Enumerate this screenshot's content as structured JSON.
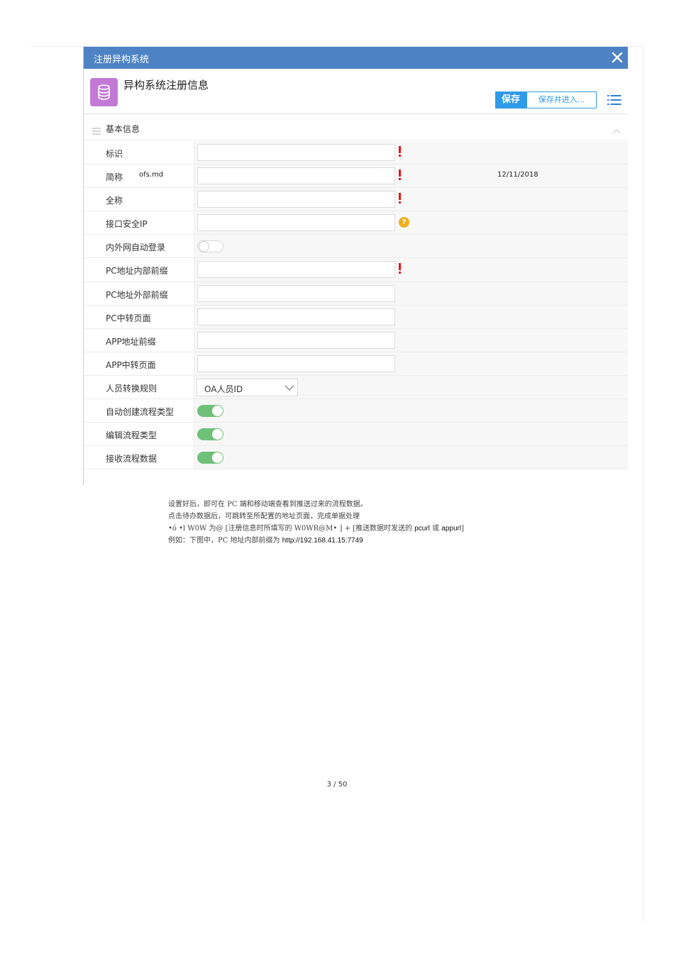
{
  "dialog": {
    "title": "注册异构系统",
    "heading": "异构系统注册信息",
    "save_label": "保存",
    "save_enter_label": "保存并进入...",
    "section_label": "基本信息",
    "rows": [
      {
        "label": "标识",
        "type": "input",
        "marker": "required"
      },
      {
        "label": "简称",
        "type": "input",
        "marker": "required"
      },
      {
        "label": "全称",
        "type": "input",
        "marker": "required"
      },
      {
        "label": "接口安全IP",
        "type": "input",
        "marker": "help"
      },
      {
        "label": "内外网自动登录",
        "type": "toggle",
        "on": false
      },
      {
        "label": "PC地址内部前缀",
        "type": "input",
        "marker": "required"
      },
      {
        "label": "PC地址外部前缀",
        "type": "input"
      },
      {
        "label": "PC中转页面",
        "type": "input"
      },
      {
        "label": "APP地址前缀",
        "type": "input"
      },
      {
        "label": "APP中转页面",
        "type": "input"
      },
      {
        "label": "人员转换规则",
        "type": "select",
        "value": "OA人员ID"
      },
      {
        "label": "自动创建流程类型",
        "type": "toggle",
        "on": true
      },
      {
        "label": "编辑流程类型",
        "type": "toggle",
        "on": true
      },
      {
        "label": "接收流程数据",
        "type": "toggle",
        "on": true
      }
    ],
    "help_glyph": "?"
  },
  "overlay": {
    "filename": "ofs.md",
    "date": "12/11/2018"
  },
  "notes": {
    "line1": "设置好后，即可在 PC 端和移动端查看到推送过来的流程数据。",
    "line2": "点击待办数据后，可跳转至所配置的地址页面，完成单据处理",
    "line3_a": "•ó •l  W0W 为@ [注册信息时所填写的  W0WR@M•  ] + [推送数据时发送的 ",
    "line3_b": "pcurl",
    "line3_c": " 或 ",
    "line3_d": "appurl",
    "line3_e": "]",
    "line4_a": "例如：下图中，PC 地址内部前缀为 ",
    "line4_b": "http://192.168.41.15:7749"
  },
  "page_number": "3 / 50",
  "colors": {
    "titlebar": "#4d83c4",
    "save_button": "#2f9ae8",
    "app_icon": "#c27ad6",
    "required": "#e81313",
    "help": "#f0ae1d",
    "toggle_on": "#6fc17a"
  }
}
